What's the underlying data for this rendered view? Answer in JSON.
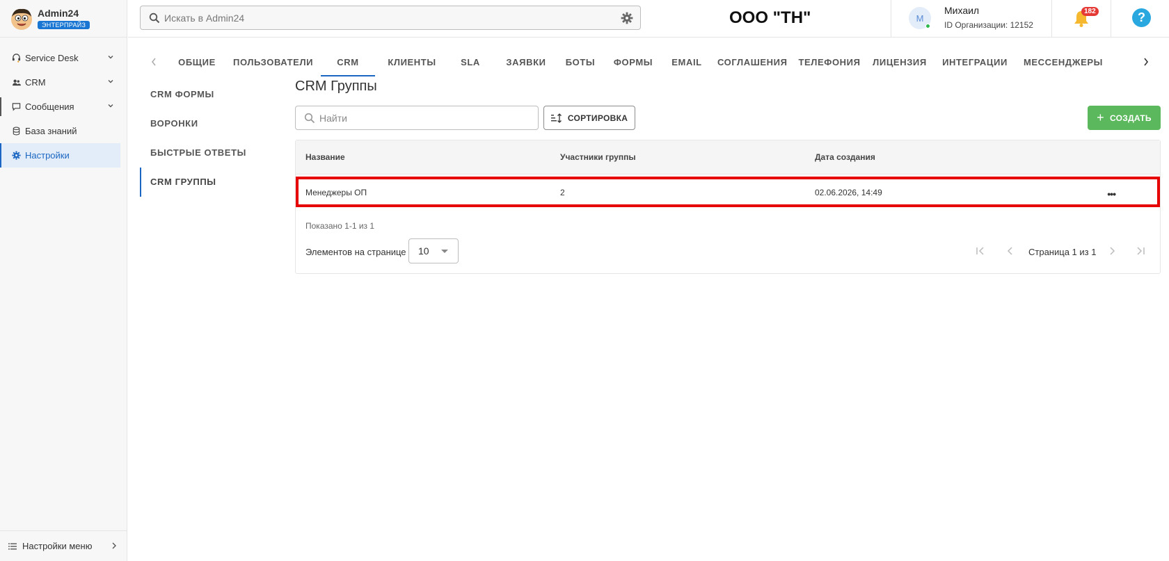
{
  "brand": {
    "name": "Admin24",
    "badge": "ЭНТЕРПРАЙЗ"
  },
  "sidebar": {
    "items": [
      {
        "label": "Service Desk",
        "icon": "headset-icon"
      },
      {
        "label": "CRM",
        "icon": "people-icon"
      },
      {
        "label": "Сообщения",
        "icon": "chat-icon"
      },
      {
        "label": "База знаний",
        "icon": "database-icon"
      },
      {
        "label": "Настройки",
        "icon": "gear-icon",
        "active": true
      }
    ],
    "footer_label": "Настройки меню"
  },
  "header": {
    "search_placeholder": "Искать в Admin24",
    "org_title": "ООО \"ТН\"",
    "user_initial": "М",
    "user_name": "Михаил",
    "user_org": "ID Организации: 12152",
    "notifications": "182",
    "help": "?"
  },
  "tabs": [
    "ОБЩИЕ",
    "ПОЛЬЗОВАТЕЛИ",
    "CRM",
    "КЛИЕНТЫ",
    "SLA",
    "ЗАЯВКИ",
    "БОТЫ",
    "ФОРМЫ",
    "EMAIL",
    "СОГЛАШЕНИЯ",
    "ТЕЛЕФОНИЯ",
    "ЛИЦЕНЗИЯ",
    "ИНТЕГРАЦИИ",
    "МЕССЕНДЖЕРЫ"
  ],
  "active_tab": "CRM",
  "subnav": [
    "CRM ФОРМЫ",
    "ВОРОНКИ",
    "БЫСТРЫЕ ОТВЕТЫ",
    "CRM ГРУППЫ"
  ],
  "main": {
    "title": "CRM Группы",
    "find_placeholder": "Найти",
    "sort_label": "СОРТИРОВКА",
    "create_label": "СОЗДАТЬ",
    "columns": [
      "Название",
      "Участники группы",
      "Дата создания"
    ],
    "rows": [
      {
        "name": "Менеджеры ОП",
        "members": "2",
        "created": "02.06.2026, 14:49"
      }
    ],
    "shown": "Показано 1-1 из 1",
    "per_page_label": "Элементов на странице",
    "per_page_value": "10",
    "page_info": "Страница 1 из 1"
  },
  "colors": {
    "accent": "#1a66c2",
    "create": "#5cb85c",
    "highlight": "#e60000"
  }
}
